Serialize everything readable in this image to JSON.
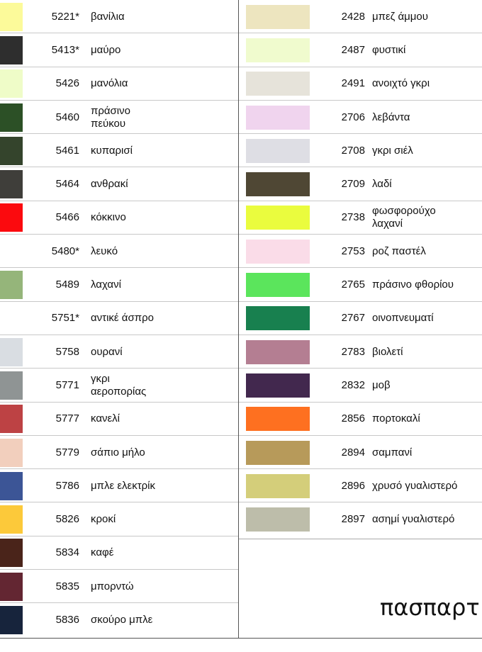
{
  "left_column": [
    {
      "code": "5221*",
      "name": [
        "βανίλια"
      ],
      "color": "#fcfa9a"
    },
    {
      "code": "5413*",
      "name": [
        "μαύρο"
      ],
      "color": "#2e2e2e"
    },
    {
      "code": "5426",
      "name": [
        "μανόλια"
      ],
      "color": "#effcc8"
    },
    {
      "code": "5460",
      "name": [
        "πράσινο",
        "πεύκου"
      ],
      "color": "#2c5026"
    },
    {
      "code": "5461",
      "name": [
        "κυπαρισί"
      ],
      "color": "#34442c"
    },
    {
      "code": "5464",
      "name": [
        "ανθρακί"
      ],
      "color": "#3f3e3a"
    },
    {
      "code": "5466",
      "name": [
        "κόκκινο"
      ],
      "color": "#fb0a0e"
    },
    {
      "code": "5480*",
      "name": [
        "λευκό"
      ],
      "color": "#ffffff"
    },
    {
      "code": "5489",
      "name": [
        "λαχανί"
      ],
      "color": "#95b57a"
    },
    {
      "code": "5751*",
      "name": [
        "αντικέ άσπρο"
      ],
      "color": "#ffffff"
    },
    {
      "code": "5758",
      "name": [
        "ουρανί"
      ],
      "color": "#d9dde2"
    },
    {
      "code": "5771",
      "name": [
        "γκρι",
        "αεροπορίας"
      ],
      "color": "#8f9494"
    },
    {
      "code": "5777",
      "name": [
        "κανελί"
      ],
      "color": "#bd4244"
    },
    {
      "code": "5779",
      "name": [
        "σάπιο μήλο"
      ],
      "color": "#f2cfbd"
    },
    {
      "code": "5786",
      "name": [
        "μπλε ελεκτρίκ"
      ],
      "color": "#3c5596"
    },
    {
      "code": "5826",
      "name": [
        "κροκί"
      ],
      "color": "#fcc93a"
    },
    {
      "code": "5834",
      "name": [
        "καφέ"
      ],
      "color": "#4a241a"
    },
    {
      "code": "5835",
      "name": [
        "μπορντώ"
      ],
      "color": "#632632"
    },
    {
      "code": "5836",
      "name": [
        "σκούρο μπλε"
      ],
      "color": "#17243c"
    }
  ],
  "right_column": [
    {
      "code": "2428",
      "name": [
        "μπεζ άμμου"
      ],
      "color": "#ede5bf"
    },
    {
      "code": "2487",
      "name": [
        "φυστικί"
      ],
      "color": "#f0fbce"
    },
    {
      "code": "2491",
      "name": [
        "ανοιχτό γκρι"
      ],
      "color": "#e6e3da"
    },
    {
      "code": "2706",
      "name": [
        "λεβάντα"
      ],
      "color": "#f0d4ee"
    },
    {
      "code": "2708",
      "name": [
        "γκρι σιέλ"
      ],
      "color": "#dedee4"
    },
    {
      "code": "2709",
      "name": [
        "λαδί"
      ],
      "color": "#4f4734"
    },
    {
      "code": "2738",
      "name": [
        "φωσφορούχο",
        "λαχανί"
      ],
      "color": "#eafc3e"
    },
    {
      "code": "2753",
      "name": [
        "ροζ παστέλ"
      ],
      "color": "#fadce8"
    },
    {
      "code": "2765",
      "name": [
        "πράσινο φθορίου"
      ],
      "color": "#5be55c"
    },
    {
      "code": "2767",
      "name": [
        "οινοπνευματί"
      ],
      "color": "#18804f"
    },
    {
      "code": "2783",
      "name": [
        "βιολετί"
      ],
      "color": "#b47e92"
    },
    {
      "code": "2832",
      "name": [
        "μοβ"
      ],
      "color": "#42284e"
    },
    {
      "code": "2856",
      "name": [
        "πορτοκαλί"
      ],
      "color": "#fe7020"
    },
    {
      "code": "2894",
      "name": [
        "σαμπανί"
      ],
      "color": "#b79a5a"
    },
    {
      "code": "2896",
      "name": [
        "χρυσό γυαλιστερό"
      ],
      "color": "#d4ce7a"
    },
    {
      "code": "2897",
      "name": [
        "ασημί γυαλιστερό"
      ],
      "color": "#bdbdaa"
    }
  ],
  "footer_title": "πασπαρτ"
}
